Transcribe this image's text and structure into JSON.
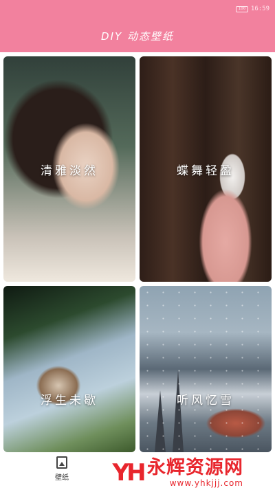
{
  "status_bar": {
    "battery": "100",
    "time": "16:59"
  },
  "header": {
    "title": "DIY 动态壁纸"
  },
  "wallpapers": [
    {
      "label": "清雅淡然"
    },
    {
      "label": "蝶舞轻盈"
    },
    {
      "label": "浮生未歇"
    },
    {
      "label": "听风忆雪"
    }
  ],
  "bottom_nav": {
    "items": [
      {
        "label": "壁纸",
        "icon": "image-icon"
      }
    ]
  },
  "watermark": {
    "logo": "YH",
    "title": "永辉资源网",
    "url": "www.yhkjjj.com"
  },
  "colors": {
    "header": "#f2819e",
    "watermark": "#e8262d"
  }
}
